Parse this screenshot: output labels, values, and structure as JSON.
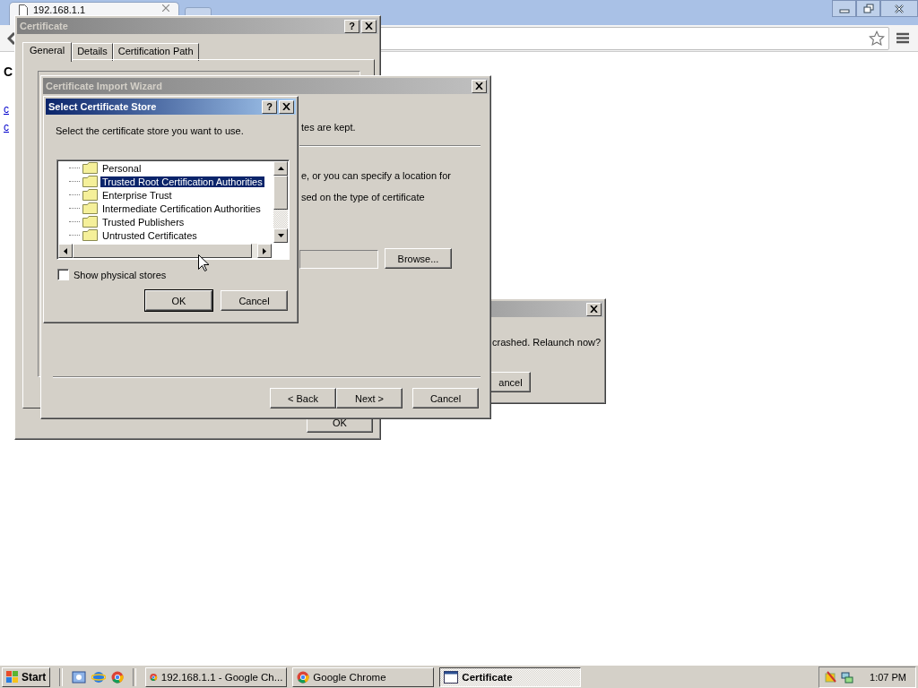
{
  "browser": {
    "tab_title": "192.168.1.1",
    "page": {
      "heading": "C",
      "links": [
        "c",
        "c"
      ]
    }
  },
  "certificate_window": {
    "title": "Certificate",
    "help": "?",
    "tabs": [
      {
        "label": "General",
        "selected": true
      },
      {
        "label": "Details",
        "selected": false
      },
      {
        "label": "Certification Path",
        "selected": false
      }
    ],
    "ok_button": "OK"
  },
  "crash_dialog": {
    "message": "crashed. Relaunch now?",
    "button": "ancel"
  },
  "import_wizard": {
    "title": "Certificate Import Wizard",
    "text_fragments": [
      "tes are kept.",
      "e, or you can specify a location for",
      "sed on the type of certificate"
    ],
    "browse_button": "Browse...",
    "buttons": [
      "< Back",
      "Next >",
      "Cancel"
    ]
  },
  "store_dialog": {
    "title": "Select Certificate Store",
    "help": "?",
    "instruction": "Select the certificate store you want to use.",
    "stores": [
      {
        "name": "Personal",
        "selected": false
      },
      {
        "name": "Trusted Root Certification Authorities",
        "selected": true
      },
      {
        "name": "Enterprise Trust",
        "selected": false
      },
      {
        "name": "Intermediate Certification Authorities",
        "selected": false
      },
      {
        "name": "Trusted Publishers",
        "selected": false
      },
      {
        "name": "Untrusted Certificates",
        "selected": false
      }
    ],
    "show_physical_stores": {
      "label": "Show physical stores",
      "checked": false
    },
    "ok_button": "OK",
    "cancel_button": "Cancel"
  },
  "taskbar": {
    "start": "Start",
    "tasks": [
      {
        "label": "192.168.1.1 - Google Ch...",
        "selected": false,
        "kind": "chrome"
      },
      {
        "label": "Google Chrome",
        "selected": false,
        "kind": "chrome"
      },
      {
        "label": "Certificate",
        "selected": true,
        "kind": "window"
      }
    ],
    "clock": "1:07 PM"
  }
}
